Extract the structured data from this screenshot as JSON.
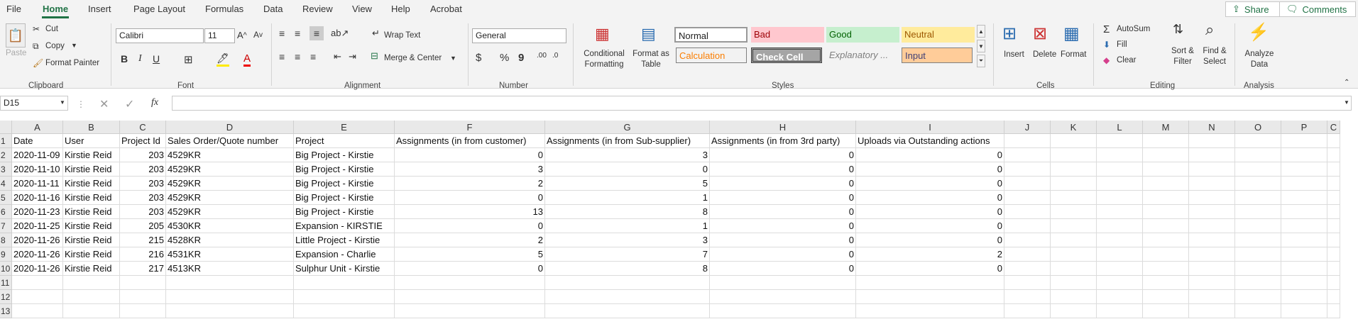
{
  "menu": {
    "tabs": [
      "File",
      "Home",
      "Insert",
      "Page Layout",
      "Formulas",
      "Data",
      "Review",
      "View",
      "Help",
      "Acrobat"
    ],
    "share": "Share",
    "comments": "Comments"
  },
  "ribbon": {
    "clipboard": {
      "paste": "Paste",
      "cut": "Cut",
      "copy": "Copy",
      "format_painter": "Format Painter",
      "group": "Clipboard"
    },
    "font": {
      "name": "Calibri",
      "size": "11",
      "bold": "B",
      "italic": "I",
      "underline": "U",
      "group": "Font"
    },
    "alignment": {
      "wrap_text": "Wrap Text",
      "merge_center": "Merge & Center",
      "group": "Alignment"
    },
    "number": {
      "format": "General",
      "group": "Number"
    },
    "styles": {
      "conditional_formatting": "Conditional Formatting",
      "format_as_table": "Format as Table",
      "cells": [
        "Normal",
        "Bad",
        "Good",
        "Neutral",
        "Calculation",
        "Check Cell",
        "Explanatory ...",
        "Input"
      ],
      "group": "Styles"
    },
    "cells_group": {
      "insert": "Insert",
      "delete": "Delete",
      "format": "Format",
      "group": "Cells"
    },
    "editing": {
      "autosum": "AutoSum",
      "fill": "Fill",
      "clear": "Clear",
      "sort_filter": "Sort & Filter",
      "find_select": "Find & Select",
      "group": "Editing"
    },
    "analysis": {
      "analyze_data": "Analyze Data",
      "group": "Analysis"
    }
  },
  "formula_bar": {
    "name_box": "D15",
    "fx": "fx",
    "content": ""
  },
  "sheet": {
    "columns": [
      "A",
      "B",
      "C",
      "D",
      "E",
      "F",
      "G",
      "H",
      "I",
      "J",
      "K",
      "L",
      "M",
      "N",
      "O",
      "P",
      "C"
    ],
    "headers": [
      "Date",
      "User",
      "Project Id",
      "Sales Order/Quote number",
      "Project",
      "Assignments (in from customer)",
      "Assignments (in from Sub-supplier)",
      "Assignments (in from 3rd party)",
      "Uploads via Outstanding actions"
    ],
    "rows": [
      [
        "2020-11-09",
        "Kirstie Reid",
        "203",
        "4529KR",
        "Big Project - Kirstie",
        "0",
        "3",
        "0",
        "0"
      ],
      [
        "2020-11-10",
        "Kirstie Reid",
        "203",
        "4529KR",
        "Big Project - Kirstie",
        "3",
        "0",
        "0",
        "0"
      ],
      [
        "2020-11-11",
        "Kirstie Reid",
        "203",
        "4529KR",
        "Big Project - Kirstie",
        "2",
        "5",
        "0",
        "0"
      ],
      [
        "2020-11-16",
        "Kirstie Reid",
        "203",
        "4529KR",
        "Big Project - Kirstie",
        "0",
        "1",
        "0",
        "0"
      ],
      [
        "2020-11-23",
        "Kirstie Reid",
        "203",
        "4529KR",
        "Big Project - Kirstie",
        "13",
        "8",
        "0",
        "0"
      ],
      [
        "2020-11-25",
        "Kirstie Reid",
        "205",
        "4530KR",
        "Expansion - KIRSTIE",
        "0",
        "1",
        "0",
        "0"
      ],
      [
        "2020-11-26",
        "Kirstie Reid",
        "215",
        "4528KR",
        "Little Project - Kirstie",
        "2",
        "3",
        "0",
        "0"
      ],
      [
        "2020-11-26",
        "Kirstie Reid",
        "216",
        "4531KR",
        "Expansion - Charlie",
        "5",
        "7",
        "0",
        "2"
      ],
      [
        "2020-11-26",
        "Kirstie Reid",
        "217",
        "4513KR",
        "Sulphur Unit - Kirstie",
        "0",
        "8",
        "0",
        "0"
      ]
    ],
    "row_numbers": [
      "1",
      "2",
      "3",
      "4",
      "5",
      "6",
      "7",
      "8",
      "9",
      "10",
      "11",
      "12",
      "13"
    ]
  },
  "colors": {
    "accent": "#217346",
    "bad_bg": "#ffc7ce",
    "bad_fg": "#9c0006",
    "good_bg": "#c6efce",
    "good_fg": "#006100",
    "neutral_bg": "#ffeb9c",
    "neutral_fg": "#9c5700",
    "input_bg": "#ffcc99",
    "calc_fg": "#fa7d00",
    "check_bg": "#a5a5a5"
  }
}
